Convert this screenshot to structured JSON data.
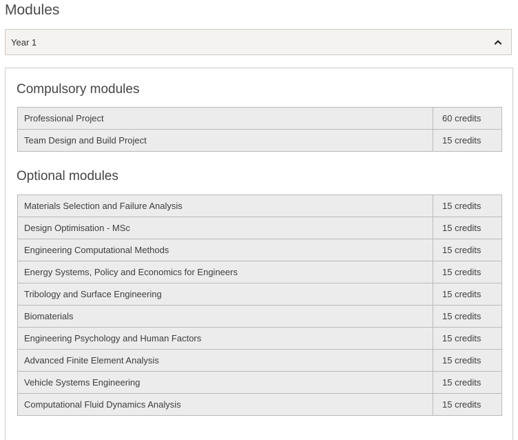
{
  "page": {
    "title": "Modules"
  },
  "accordion": {
    "label": "Year 1",
    "chevron_icon": "chevron-up-icon"
  },
  "compulsory": {
    "heading": "Compulsory modules",
    "rows": [
      {
        "name": "Professional Project",
        "credits": "60 credits"
      },
      {
        "name": "Team Design and Build Project",
        "credits": "15 credits"
      }
    ]
  },
  "optional": {
    "heading": "Optional modules",
    "rows": [
      {
        "name": "Materials Selection and Failure Analysis",
        "credits": "15 credits"
      },
      {
        "name": "Design Optimisation - MSc",
        "credits": "15 credits"
      },
      {
        "name": "Engineering Computational Methods",
        "credits": "15 credits"
      },
      {
        "name": "Energy Systems, Policy and Economics for Engineers",
        "credits": "15 credits"
      },
      {
        "name": "Tribology and Surface Engineering",
        "credits": "15 credits"
      },
      {
        "name": "Biomaterials",
        "credits": "15 credits"
      },
      {
        "name": "Engineering Psychology and Human Factors",
        "credits": "15 credits"
      },
      {
        "name": "Advanced Finite Element Analysis",
        "credits": "15 credits"
      },
      {
        "name": "Vehicle Systems Engineering",
        "credits": "15 credits"
      },
      {
        "name": "Computational Fluid Dynamics Analysis",
        "credits": "15 credits"
      }
    ]
  }
}
